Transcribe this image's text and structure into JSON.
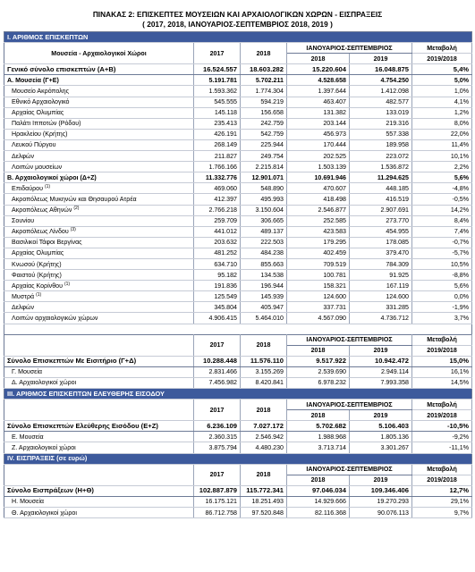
{
  "title_line1": "ΠΙΝΑΚΑΣ 2: ΕΠΙΣΚΕΠΤΕΣ ΜΟΥΣΕΙΩΝ ΚΑΙ ΑΡΧΑΙΟΛΟΓΙΚΩΝ ΧΩΡΩΝ - ΕΙΣΠΡΑΞΕΙΣ",
  "title_line2": "( 2017, 2018, ΙΑΝΟΥΑΡΙΟΣ-ΣΕΠΤΕΜΒΡΙΟΣ 2018, 2019 )",
  "headers": {
    "col_label": "Μουσεία - Αρχαιολογικοί Χώροι",
    "y2017": "2017",
    "y2018": "2018",
    "period": "ΙΑΝΟΥΑΡΙΟΣ-ΣΕΠΤΕΜΒΡΙΟΣ",
    "p2018": "2018",
    "p2019": "2019",
    "change1": "Μεταβολή",
    "change2": "2019/2018"
  },
  "sections": [
    {
      "title": "Ι. ΑΡΙΘΜΟΣ  ΕΠΙΣΚΕΠΤΩΝ",
      "header_label": "Μουσεία - Αρχαιολογικοί Χώροι",
      "rows": [
        {
          "type": "total",
          "label": "Γενικό  σύνολο επισκεπτών (Α+Β)",
          "v": [
            "16.524.557",
            "18.603.282",
            "15.220.604",
            "16.048.875",
            "5,4%"
          ]
        },
        {
          "type": "sub",
          "label": "Α. Μουσεία (Γ+Ε)",
          "v": [
            "5.191.781",
            "5.702.211",
            "4.528.658",
            "4.754.250",
            "5,0%"
          ]
        },
        {
          "type": "item",
          "label": "Μουσείο Ακρόπολης",
          "v": [
            "1.593.362",
            "1.774.304",
            "1.397.644",
            "1.412.098",
            "1,0%"
          ]
        },
        {
          "type": "item",
          "label": "Εθνικό Αρχαιολογικό",
          "v": [
            "545.555",
            "594.219",
            "463.407",
            "482.577",
            "4,1%"
          ]
        },
        {
          "type": "item",
          "label": "Αρχαίας Ολυμπίας",
          "v": [
            "145.118",
            "156.658",
            "131.382",
            "133.019",
            "1,2%"
          ]
        },
        {
          "type": "item",
          "label": "Παλάτι Ιπποτών (Ρόδου)",
          "v": [
            "235.413",
            "242.759",
            "203.144",
            "219.316",
            "8,0%"
          ]
        },
        {
          "type": "item",
          "label": "Ηρακλείου (Κρήτης)",
          "v": [
            "426.191",
            "542.759",
            "456.973",
            "557.338",
            "22,0%"
          ]
        },
        {
          "type": "item",
          "label": "Λευκού Πύργου",
          "v": [
            "268.149",
            "225.944",
            "170.444",
            "189.958",
            "11,4%"
          ]
        },
        {
          "type": "item",
          "label": "Δελφών",
          "v": [
            "211.827",
            "249.754",
            "202.525",
            "223.072",
            "10,1%"
          ]
        },
        {
          "type": "item",
          "label": "Λοιπών μουσείων",
          "v": [
            "1.766.166",
            "2.215.814",
            "1.503.139",
            "1.536.872",
            "2,2%"
          ]
        },
        {
          "type": "sub",
          "label": "Β. Αρχαιολογικοί χώροι (Δ+Ζ)",
          "v": [
            "11.332.776",
            "12.901.071",
            "10.691.946",
            "11.294.625",
            "5,6%"
          ]
        },
        {
          "type": "item",
          "label": "Επιδαύρου",
          "sup": "(1)",
          "v": [
            "469.060",
            "548.890",
            "470.607",
            "448.185",
            "-4,8%"
          ]
        },
        {
          "type": "item",
          "label": "Ακροπόλεως Μυκηνών και Θησαυρού Ατρέα",
          "v": [
            "412.397",
            "495.993",
            "418.498",
            "416.519",
            "-0,5%"
          ]
        },
        {
          "type": "item",
          "label": "Ακροπόλεως Αθηνών",
          "sup": "(2)",
          "v": [
            "2.766.218",
            "3.150.604",
            "2.546.877",
            "2.907.691",
            "14,2%"
          ]
        },
        {
          "type": "item",
          "label": "Σουνίου",
          "v": [
            "259.709",
            "306.665",
            "252.585",
            "273.770",
            "8,4%"
          ]
        },
        {
          "type": "item",
          "label": "Ακροπόλεως Λίνδου",
          "sup": "(3)",
          "v": [
            "441.012",
            "489.137",
            "423.583",
            "454.955",
            "7,4%"
          ]
        },
        {
          "type": "item",
          "label": "Βασιλικοί Τάφοι Βεργίνας",
          "v": [
            "203.632",
            "222.503",
            "179.295",
            "178.085",
            "-0,7%"
          ]
        },
        {
          "type": "item",
          "label": "Αρχαίας Ολυμπίας",
          "v": [
            "481.252",
            "484.238",
            "402.459",
            "379.470",
            "-5,7%"
          ]
        },
        {
          "type": "item",
          "label": "Κνωσού (Κρήτης)",
          "v": [
            "634.710",
            "855.663",
            "709.519",
            "784.309",
            "10,5%"
          ]
        },
        {
          "type": "item",
          "label": "Φαιστού (Κρήτης)",
          "v": [
            "95.182",
            "134.538",
            "100.781",
            "91.925",
            "-8,8%"
          ]
        },
        {
          "type": "item",
          "label": "Αρχαίας Κορίνθου",
          "sup": "(1)",
          "v": [
            "191.836",
            "196.944",
            "158.321",
            "167.119",
            "5,6%"
          ]
        },
        {
          "type": "item",
          "label": "Μυστρά",
          "sup": "(1)",
          "v": [
            "125.549",
            "145.939",
            "124.600",
            "124.600",
            "0,0%"
          ]
        },
        {
          "type": "item",
          "label": "Δελφών",
          "v": [
            "345.804",
            "405.947",
            "337.731",
            "331.285",
            "-1,9%"
          ]
        },
        {
          "type": "item",
          "label": "Λοιπών αρχαιολογικών χώρων",
          "v": [
            "4.906.415",
            "5.464.010",
            "4.567.090",
            "4.736.712",
            "3,7%"
          ]
        }
      ]
    },
    {
      "title": "",
      "rows": [
        {
          "type": "total",
          "label": "Σύνολο Επισκεπτών Με Εισιτήριο (Γ+Δ)",
          "v": [
            "10.288.448",
            "11.576.110",
            "9.517.922",
            "10.942.472",
            "15,0%"
          ]
        },
        {
          "type": "item",
          "label": "Γ. Μουσεία",
          "v": [
            "2.831.466",
            "3.155.269",
            "2.539.690",
            "2.949.114",
            "16,1%"
          ]
        },
        {
          "type": "item",
          "label": "Δ. Αρχαιολογικοί χώροι",
          "v": [
            "7.456.982",
            "8.420.841",
            "6.978.232",
            "7.993.358",
            "14,5%"
          ]
        }
      ]
    },
    {
      "title": "ΙΙΙ. ΑΡΙΘΜΟΣ  ΕΠΙΣΚΕΠΤΩΝ ΕΛΕΥΘΕΡΗΣ ΕΙΣΟΔΟΥ",
      "rows": [
        {
          "type": "total",
          "label": "Σύνολο Επισκεπτών Ελεύθερης Εισόδου (Ε+Ζ)",
          "v": [
            "6.236.109",
            "7.027.172",
            "5.702.682",
            "5.106.403",
            "-10,5%"
          ]
        },
        {
          "type": "item",
          "label": "Ε. Μουσεία",
          "v": [
            "2.360.315",
            "2.546.942",
            "1.988.968",
            "1.805.136",
            "-9,2%"
          ]
        },
        {
          "type": "item",
          "label": "Ζ. Αρχαιολογικοί χώροι",
          "v": [
            "3.875.794",
            "4.480.230",
            "3.713.714",
            "3.301.267",
            "-11,1%"
          ]
        }
      ]
    },
    {
      "title": "IV. ΕΙΣΠΡΑΞΕΙΣ (σε ευρώ)",
      "rows": [
        {
          "type": "total",
          "label": "Σύνολο Εισπράξεων (Η+Θ)",
          "v": [
            "102.887.879",
            "115.772.341",
            "97.046.034",
            "109.346.406",
            "12,7%"
          ]
        },
        {
          "type": "item",
          "label": "Η. Μουσεία",
          "v": [
            "16.175.121",
            "18.251.493",
            "14.929.666",
            "19.270.293",
            "29,1%"
          ]
        },
        {
          "type": "item",
          "label": "Θ. Αρχαιολογικοί χώροι",
          "v": [
            "86.712.758",
            "97.520.848",
            "82.116.368",
            "90.076.113",
            "9,7%"
          ]
        }
      ]
    }
  ]
}
